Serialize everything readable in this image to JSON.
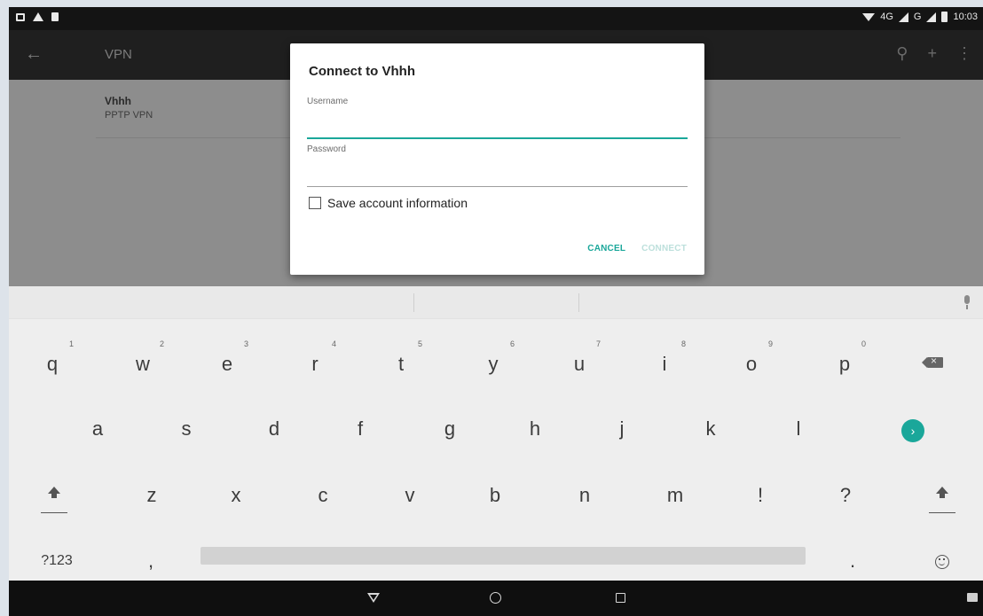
{
  "status_bar": {
    "icons_left": [
      "message-icon",
      "warning-icon",
      "sim-icon"
    ],
    "network": "4G",
    "network2": "G",
    "time": "10:03"
  },
  "app_bar": {
    "title": "VPN",
    "actions": [
      "search-icon",
      "add-icon",
      "overflow-menu-icon"
    ]
  },
  "vpn_list": {
    "items": [
      {
        "name": "Vhhh",
        "type": "PPTP VPN"
      }
    ]
  },
  "dialog": {
    "title": "Connect to Vhhh",
    "username_label": "Username",
    "username_value": "",
    "password_label": "Password",
    "password_value": "",
    "save_label": "Save account information",
    "save_checked": false,
    "cancel_label": "CANCEL",
    "connect_label": "CONNECT",
    "accent_color": "#1aa79a"
  },
  "keyboard": {
    "row1": [
      {
        "k": "q",
        "h": "1"
      },
      {
        "k": "w",
        "h": "2"
      },
      {
        "k": "e",
        "h": "3"
      },
      {
        "k": "r",
        "h": "4"
      },
      {
        "k": "t",
        "h": "5"
      },
      {
        "k": "y",
        "h": "6"
      },
      {
        "k": "u",
        "h": "7"
      },
      {
        "k": "i",
        "h": "8"
      },
      {
        "k": "o",
        "h": "9"
      },
      {
        "k": "p",
        "h": "0"
      }
    ],
    "row2": [
      "a",
      "s",
      "d",
      "f",
      "g",
      "h",
      "j",
      "k",
      "l"
    ],
    "row3": [
      "z",
      "x",
      "c",
      "v",
      "b",
      "n",
      "m",
      "!",
      "?"
    ],
    "symbols_label": "?123",
    "comma": ",",
    "period": "."
  }
}
